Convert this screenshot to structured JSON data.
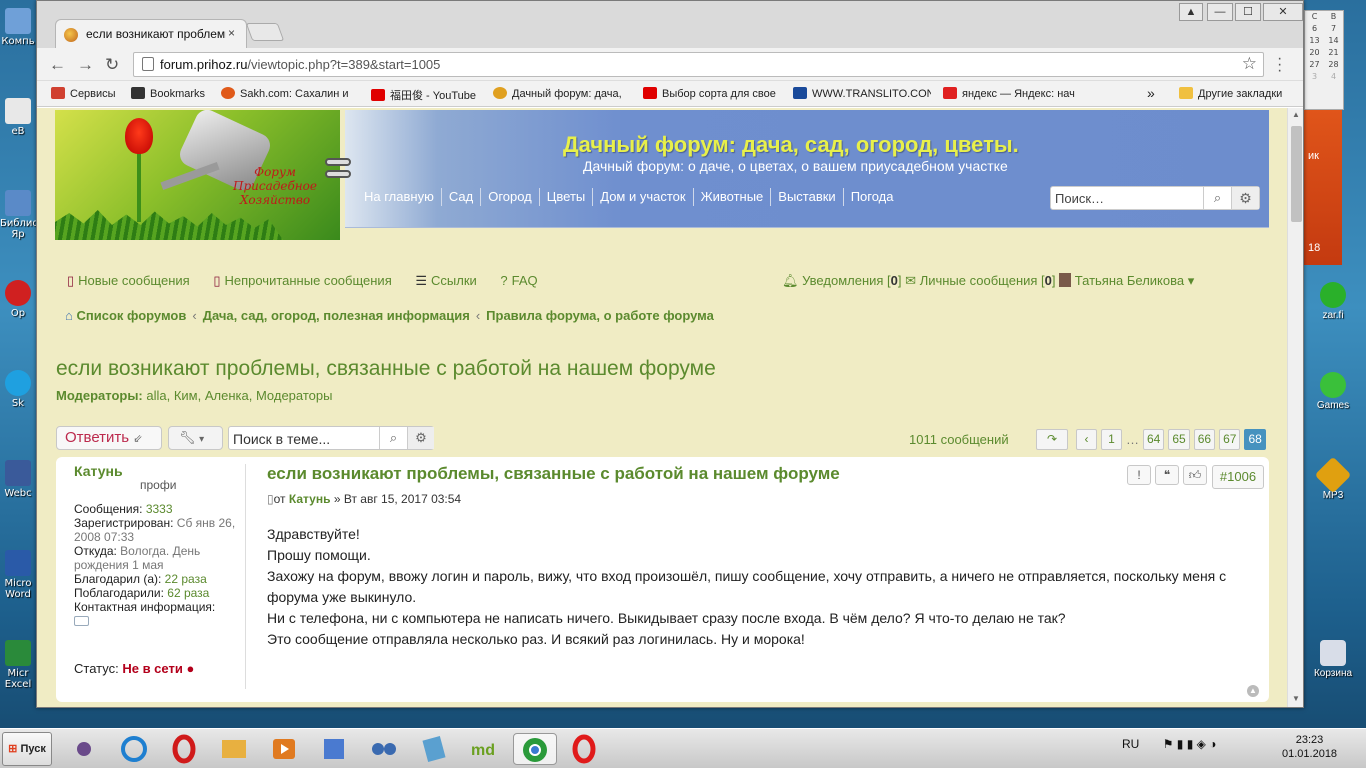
{
  "desktop": {
    "left_icons": [
      "Компь",
      "eB",
      "Библио Яр",
      "Op",
      "Sk",
      "Webc",
      "Micro Word",
      "Micr Excel"
    ],
    "right_icons": [
      "ик",
      "18",
      "zar.fi",
      "Games",
      "MP3",
      "Корзина"
    ],
    "calendar": {
      "rows": [
        [
          "",
          "С",
          "В"
        ],
        [
          "",
          "6",
          "7"
        ],
        [
          "",
          "13",
          "14"
        ],
        [
          "",
          "20",
          "21"
        ],
        [
          "",
          "27",
          "28"
        ],
        [
          "",
          "3",
          "4"
        ]
      ]
    }
  },
  "browser": {
    "tab_title": "если возникают проблемы, связанные с работой на нашем форуме",
    "tab_close": "×",
    "window_controls": [
      "▲",
      "—",
      "☐",
      "✕"
    ],
    "url_host": "forum.prihoz.ru",
    "url_path": "/viewtopic.php?t=389&start=1005",
    "bookmarks": [
      {
        "label": "Сервисы",
        "color": "#d04030"
      },
      {
        "label": "Bookmarks",
        "color": "#333333"
      },
      {
        "label": "Sakh.com: Сахалин и",
        "color": "#e05a1a"
      },
      {
        "label": "福田俊 - YouTube",
        "color": "#e00000"
      },
      {
        "label": "Дачный форум: дача,",
        "color": "#e0a020"
      },
      {
        "label": "Выбор сорта для свое",
        "color": "#e00000"
      },
      {
        "label": "WWW.TRANSLITO.CON",
        "color": "#1a4a9a"
      },
      {
        "label": "яндекс — Яндекс: нач",
        "color": "#e02020"
      }
    ],
    "bookmarks_more": "»",
    "other_bookmarks": "Другие закладки"
  },
  "site": {
    "logo_text": "Форум Присадебное Хозяйство",
    "title": "Дачный форум: дача, сад, огород, цветы.",
    "description": "Дачный форум: о даче, о цветах, о вашем приусадебном участке",
    "nav": [
      "На главную",
      "Сад",
      "Огород",
      "Цветы",
      "Дом и участок",
      "Животные",
      "Выставки",
      "Погода"
    ],
    "search_placeholder": "Поиск…"
  },
  "quicklinks": {
    "new_posts": "Новые сообщения",
    "unread_posts": "Непрочитанные сообщения",
    "links": "Ссылки",
    "faq": "FAQ",
    "notifications": "Уведомления",
    "notifications_count": "0",
    "private_messages": "Личные сообщения",
    "pm_count": "0",
    "username": "Татьяна Беликова"
  },
  "breadcrumbs": [
    "Список форумов",
    "Дача, сад, огород, полезная информация",
    "Правила форума, о работе форума"
  ],
  "topic": {
    "title": "если возникают проблемы, связанные с работой на нашем форуме",
    "moderators_label": "Модераторы:",
    "moderators": "alla, Ким, Аленка, Модераторы",
    "reply_label": "Ответить",
    "search_placeholder": "Поиск в теме...",
    "post_count": "1011 сообщений",
    "pages": [
      "1",
      "64",
      "65",
      "66",
      "67",
      "68"
    ],
    "current_page": "68"
  },
  "post": {
    "title": "если возникают проблемы, связанные с работой на нашем форуме",
    "meta_from": "от",
    "author": "Катунь",
    "date": "» Вт авг 15, 2017 03:54",
    "number": "#1006",
    "body": [
      "Здравствуйте!",
      "Прошу помощи.",
      "Захожу на форум, ввожу логин и пароль, вижу, что вход произошёл, пишу сообщение, хочу отправить, а ничего не отправляется, поскольку меня с форума уже выкинуло.",
      "Ни с телефона, ни с компьютера не написать ничего. Выкидывает сразу после входа. В чём дело? Я что-то делаю не так?",
      "Это сообщение отправляла несколько раз. И всякий раз логинилась. Ну и морока!"
    ]
  },
  "profile": {
    "name": "Катунь",
    "rank": "профи",
    "posts_label": "Сообщения:",
    "posts": "3333",
    "registered_label": "Зарегистрирован:",
    "registered": "Сб янв 26, 2008 07:33",
    "from_label": "Откуда:",
    "from": "Вологда. День рождения 1 мая",
    "thanked_label": "Благодарил (а):",
    "thanked": "22 раза",
    "thanks_label": "Поблагодарили:",
    "thanks": "62 раза",
    "contact_label": "Контактная информация:",
    "status_label": "Статус:",
    "status": "Не в сети"
  },
  "taskbar": {
    "start": "Пуск",
    "lang": "RU",
    "time": "23:23",
    "date": "01.01.2018",
    "apps": [
      {
        "name": "spider-icon",
        "color": "#6a4a8a"
      },
      {
        "name": "ie-icon",
        "color": "#1e7fd0"
      },
      {
        "name": "opera-icon",
        "color": "#d01a1a"
      },
      {
        "name": "explorer-icon",
        "color": "#e8b040"
      },
      {
        "name": "media-icon",
        "color": "#e07a20"
      },
      {
        "name": "paint-icon",
        "color": "#4a7ad0"
      },
      {
        "name": "eyes-icon",
        "color": "#3a6ab0"
      },
      {
        "name": "notepad-icon",
        "color": "#5aa0d0"
      },
      {
        "name": "md-icon",
        "color": "#6aa020"
      },
      {
        "name": "chrome-icon",
        "color": "#2a9a3a"
      },
      {
        "name": "opera2-icon",
        "color": "#e01a1a"
      }
    ]
  }
}
